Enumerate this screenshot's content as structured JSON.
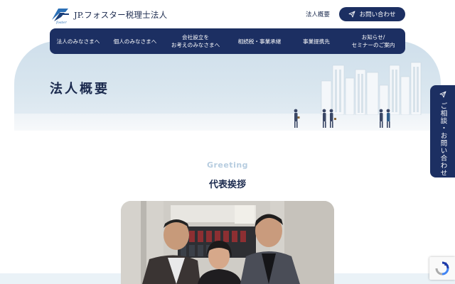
{
  "header": {
    "logo_text": "JP.フォスター税理士法人",
    "logo_sub": "foster",
    "company_link": "法人概要",
    "contact_button": "お問い合わせ"
  },
  "nav": {
    "items": [
      {
        "line1": "法人のみなさまへ",
        "line2": ""
      },
      {
        "line1": "個人のみなさまへ",
        "line2": ""
      },
      {
        "line1": "会社設立を",
        "line2": "お考えのみなさまへ"
      },
      {
        "line1": "相続税・事業承継",
        "line2": ""
      },
      {
        "line1": "事業提携先",
        "line2": ""
      },
      {
        "line1": "お知らせ/",
        "line2": "セミナーのご案内"
      }
    ]
  },
  "hero": {
    "title": "法人概要"
  },
  "side_tab": {
    "label": "ご相談・お問い合わせ"
  },
  "greeting": {
    "en": "Greeting",
    "jp": "代表挨拶"
  },
  "colors": {
    "navy": "#1c2f62",
    "hero_bg": "#d4e3ee",
    "greeting_en": "#b7cde0"
  }
}
